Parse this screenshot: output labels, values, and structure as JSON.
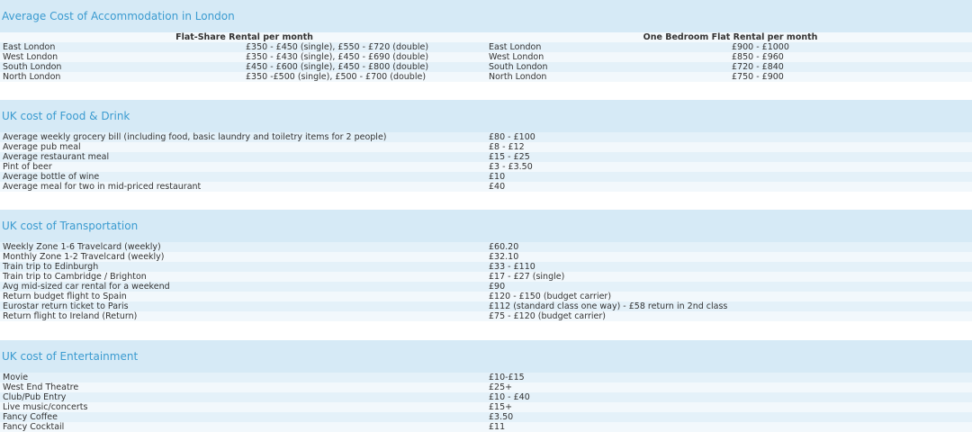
{
  "accommodation": {
    "title": "Average Cost of Accommodation in London",
    "flatshare_header": "Flat-Share Rental per month",
    "onebed_header": "One Bedroom Flat Rental per month",
    "rows": [
      {
        "area1": "East London",
        "price1": "£350 - £450 (single), £550 - £720 (double)",
        "area2": "East London",
        "price2": "£900 - £1000"
      },
      {
        "area1": "West London",
        "price1": "£350 - £430 (single), £450 - £690 (double)",
        "area2": "West London",
        "price2": "£850 - £960"
      },
      {
        "area1": "South London",
        "price1": "£450 - £600 (single), £450 - £800 (double)",
        "area2": "South London",
        "price2": "£720 - £840"
      },
      {
        "area1": "North London",
        "price1": "£350 -£500 (single), £500 - £700 (double)",
        "area2": "North London",
        "price2": "£750 - £900"
      }
    ]
  },
  "food": {
    "title": "UK cost of Food & Drink",
    "rows": [
      {
        "item": "Average weekly grocery bill (including food, basic laundry and toiletry items for 2 people)",
        "price": "£80 - £100"
      },
      {
        "item": "Average pub meal",
        "price": "£8 - £12"
      },
      {
        "item": "Average restaurant meal",
        "price": "£15 - £25"
      },
      {
        "item": "Pint of beer",
        "price": "£3 - £3.50"
      },
      {
        "item": "Average bottle of wine",
        "price": "£10"
      },
      {
        "item": "Average meal for two in mid-priced restaurant",
        "price": "£40"
      }
    ]
  },
  "transport": {
    "title": "UK cost of Transportation",
    "rows": [
      {
        "item": "Weekly Zone 1-6 Travelcard (weekly)",
        "price": "£60.20"
      },
      {
        "item": "Monthly Zone 1-2 Travelcard (weekly)",
        "price": "£32.10"
      },
      {
        "item": "Train trip to Edinburgh",
        "price": "£33 - £110"
      },
      {
        "item": "Train trip to Cambridge / Brighton",
        "price": "£17 - £27 (single)"
      },
      {
        "item": "Avg mid-sized car rental for a weekend",
        "price": "£90"
      },
      {
        "item": "Return budget flight to Spain",
        "price": "£120 - £150 (budget carrier)"
      },
      {
        "item": "Eurostar return ticket to Paris",
        "price": "£112 (standard class one way) - £58 return in 2nd class"
      },
      {
        "item": "Return flight to Ireland (Return)",
        "price": "£75 - £120 (budget carrier)"
      }
    ]
  },
  "entertainment": {
    "title": "UK cost of Entertainment",
    "rows": [
      {
        "item": "Movie",
        "price": "£10-£15"
      },
      {
        "item": "West End Theatre",
        "price": "£25+"
      },
      {
        "item": "Club/Pub Entry",
        "price": "£10 - £40"
      },
      {
        "item": "Live music/concerts",
        "price": "£15+"
      },
      {
        "item": "Fancy Coffee",
        "price": "£3.50"
      },
      {
        "item": "Fancy Cocktail",
        "price": "£11"
      }
    ]
  }
}
